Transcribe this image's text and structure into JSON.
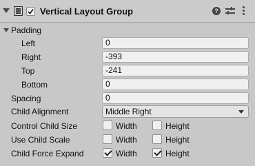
{
  "header": {
    "title": "Vertical Layout Group",
    "help_icon": "help-icon",
    "presets_icon": "presets-icon",
    "menu_icon": "kebab-menu-icon",
    "enabled": true
  },
  "padding": {
    "label": "Padding",
    "left": {
      "label": "Left",
      "value": "0"
    },
    "right": {
      "label": "Right",
      "value": "-393"
    },
    "top": {
      "label": "Top",
      "value": "-241"
    },
    "bottom": {
      "label": "Bottom",
      "value": "0"
    }
  },
  "spacing": {
    "label": "Spacing",
    "value": "0"
  },
  "child_alignment": {
    "label": "Child Alignment",
    "value": "Middle Right"
  },
  "control_child_size": {
    "label": "Control Child Size",
    "width_label": "Width",
    "height_label": "Height",
    "width": false,
    "height": false
  },
  "use_child_scale": {
    "label": "Use Child Scale",
    "width_label": "Width",
    "height_label": "Height",
    "width": false,
    "height": false
  },
  "child_force_expand": {
    "label": "Child Force Expand",
    "width_label": "Width",
    "height_label": "Height",
    "width": true,
    "height": true
  }
}
